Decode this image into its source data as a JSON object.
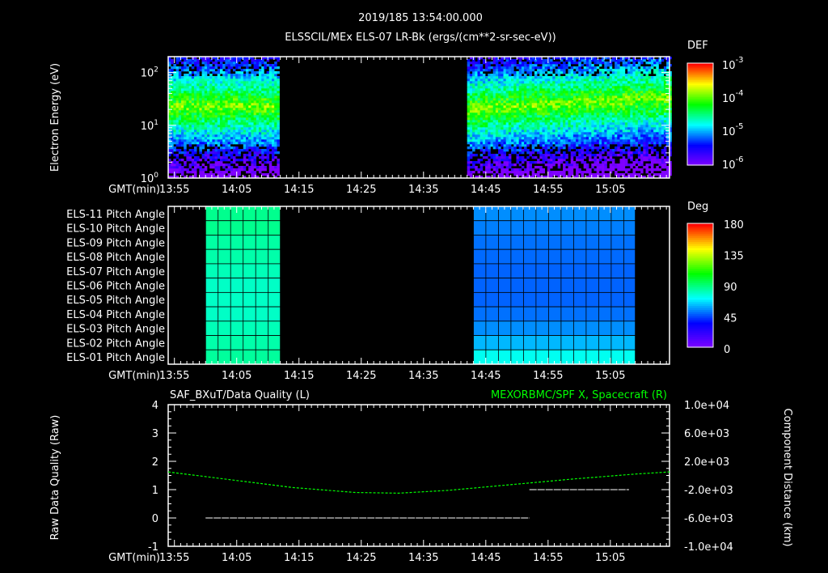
{
  "header": {
    "timestamp": "2019/185 13:54:00.000",
    "title": "ELSSCIL/MEx ELS-07 LR-Bk  (ergs/(cm**2-sr-sec-eV))"
  },
  "colors": {
    "background": "#000000",
    "axes": "#ffffff",
    "right_series": "#00ff00"
  },
  "chart_data": [
    {
      "type": "heatmap",
      "name": "energy-spectrogram",
      "ylabel": "Electron Energy (eV)",
      "yscale": "log",
      "ylim": [
        1,
        200
      ],
      "yticks": [
        "10^0",
        "10^1",
        "10^2"
      ],
      "xlabel": "GMT(min)",
      "xlim_min": [
        0,
        80.5
      ],
      "xticks": [
        "13:55",
        "14:05",
        "14:15",
        "14:25",
        "14:35",
        "14:45",
        "14:55",
        "15:05"
      ],
      "data_intervals": [
        [
          "13:54",
          "14:11"
        ],
        [
          "14:42",
          "15:14"
        ]
      ],
      "peak_energy_eV": [
        20,
        20
      ],
      "colorbar": {
        "label": "DEF",
        "scale": "log",
        "ticks": [
          "10^-3",
          "10^-4",
          "10^-5",
          "10^-6"
        ],
        "range": [
          1e-06,
          0.001
        ]
      }
    },
    {
      "type": "heatmap",
      "name": "pitch-angle",
      "rows": [
        "ELS-11 Pitch Angle",
        "ELS-10 Pitch Angle",
        "ELS-09 Pitch Angle",
        "ELS-08 Pitch Angle",
        "ELS-07 Pitch Angle",
        "ELS-06 Pitch Angle",
        "ELS-05 Pitch Angle",
        "ELS-04 Pitch Angle",
        "ELS-03 Pitch Angle",
        "ELS-02 Pitch Angle",
        "ELS-01 Pitch Angle"
      ],
      "xlabel": "GMT(min)",
      "xticks": [
        "13:55",
        "14:05",
        "14:15",
        "14:25",
        "14:35",
        "14:45",
        "14:55",
        "15:05"
      ],
      "blocks": [
        {
          "start": "14:00",
          "end": "14:12",
          "values_deg": [
            88,
            88,
            85,
            84,
            82,
            80,
            80,
            80,
            82,
            84,
            86
          ]
        },
        {
          "start": "14:43",
          "end": "15:09",
          "values_deg": [
            56,
            54,
            52,
            51,
            50,
            50,
            50,
            52,
            56,
            62,
            74
          ]
        }
      ],
      "colorbar": {
        "label": "Deg",
        "ticks": [
          "180",
          "135",
          "90",
          "45",
          "0"
        ],
        "range": [
          0,
          180
        ]
      }
    },
    {
      "type": "line",
      "name": "quality-and-position",
      "left_title": "SAF_BXuT/Data Quality (L)",
      "right_title": "MEXORBMC/SPF X, Spacecraft (R)",
      "ylabel_left": "Raw Data Quality (Raw)",
      "ylabel_right": "Component Distance (km)",
      "ylim_left": [
        -1,
        4
      ],
      "yticks_left": [
        "4",
        "3",
        "2",
        "1",
        "0",
        "-1"
      ],
      "ylim_right": [
        -10000,
        10000
      ],
      "yticks_right": [
        "1.0e+04",
        "6.0e+03",
        "2.0e+03",
        "-2.0e+03",
        "-6.0e+03",
        "-1.0e+04"
      ],
      "xlabel": "GMT(min)",
      "xticks": [
        "13:55",
        "14:05",
        "14:15",
        "14:25",
        "14:35",
        "14:45",
        "14:55",
        "15:05"
      ],
      "series": [
        {
          "name": "Data Quality",
          "axis": "left",
          "segments": [
            {
              "start_min": 6,
              "end_min": 58,
              "value": 0
            },
            {
              "start_min": 58,
              "end_min": 74,
              "value": 1
            }
          ]
        },
        {
          "name": "SPF X",
          "axis": "right",
          "x_min": [
            0,
            10,
            20,
            30,
            37,
            45,
            55,
            65,
            75,
            80.5
          ],
          "values_km": [
            500,
            -600,
            -1700,
            -2400,
            -2500,
            -2100,
            -1300,
            -500,
            200,
            500
          ]
        }
      ]
    }
  ]
}
